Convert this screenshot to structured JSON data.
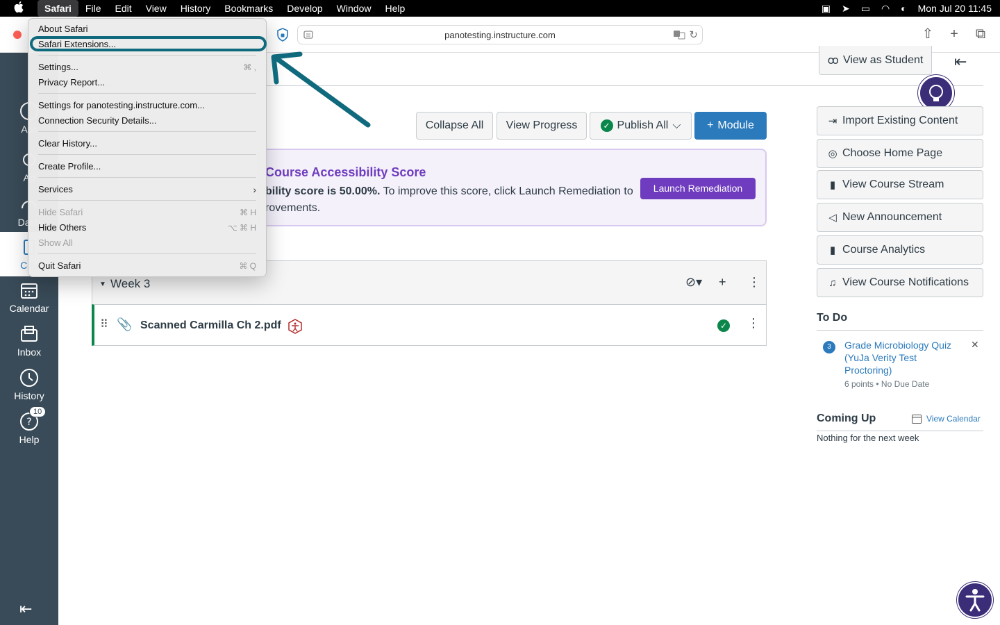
{
  "menubar": {
    "app": "Safari",
    "items": [
      "File",
      "Edit",
      "View",
      "History",
      "Bookmarks",
      "Develop",
      "Window",
      "Help"
    ],
    "clock": "Mon Jul 20  11:45"
  },
  "browser": {
    "url": "panotesting.instructure.com"
  },
  "safari_menu": {
    "items": [
      {
        "label": "About Safari",
        "shortcut": ""
      },
      {
        "label": "Safari Extensions...",
        "shortcut": ""
      },
      {
        "label": "Settings...",
        "shortcut": "⌘ ,"
      },
      {
        "label": "Privacy Report...",
        "shortcut": ""
      },
      {
        "label": "Settings for panotesting.instructure.com...",
        "shortcut": ""
      },
      {
        "label": "Connection Security Details...",
        "shortcut": ""
      },
      {
        "label": "Clear History...",
        "shortcut": ""
      },
      {
        "label": "Create Profile...",
        "shortcut": ""
      },
      {
        "label": "Services",
        "shortcut": "›"
      },
      {
        "label": "Hide Safari",
        "shortcut": "⌘ H"
      },
      {
        "label": "Hide Others",
        "shortcut": "⌥ ⌘ H"
      },
      {
        "label": "Show All",
        "shortcut": ""
      },
      {
        "label": "Quit Safari",
        "shortcut": "⌘ Q"
      }
    ]
  },
  "sidebar": {
    "items": [
      {
        "label": "Acc"
      },
      {
        "label": "Ad"
      },
      {
        "label": "Dash"
      },
      {
        "label": "Cou"
      },
      {
        "label": "Calendar"
      },
      {
        "label": "Inbox"
      },
      {
        "label": "History"
      },
      {
        "label": "Help"
      }
    ],
    "help_badge": "10"
  },
  "toolbar_buttons": {
    "collapse_all": "Collapse All",
    "view_progress": "View Progress",
    "publish_all": "Publish All",
    "module": "Module"
  },
  "accessibility": {
    "title": "Course Accessibility Score",
    "text_prefix": "bility score is 50.00%.",
    "text_rest": " To improve this score, click Launch Remediation to",
    "text_line2": "rovements.",
    "launch": "Launch Remediation"
  },
  "module": {
    "title": "Week 3",
    "item_name": "Scanned Carmilla Ch 2.pdf"
  },
  "right": {
    "view_as_student": "View as Student",
    "buttons": [
      "Import Existing Content",
      "Choose Home Page",
      "View Course Stream",
      "New Announcement",
      "Course Analytics",
      "View Course Notifications"
    ],
    "todo_heading": "To Do",
    "todo_count": "3",
    "todo_link": "Grade Microbiology Quiz (YuJa Verity Test Proctoring)",
    "todo_meta": "6 points • No Due Date",
    "coming_up": "Coming Up",
    "view_calendar": "View Calendar",
    "nothing": "Nothing for the next week"
  },
  "colors": {
    "annotation": "#106a7d",
    "canvas_nav": "#394b58",
    "primary": "#2b7abc",
    "purple": "#6f3cbf"
  }
}
